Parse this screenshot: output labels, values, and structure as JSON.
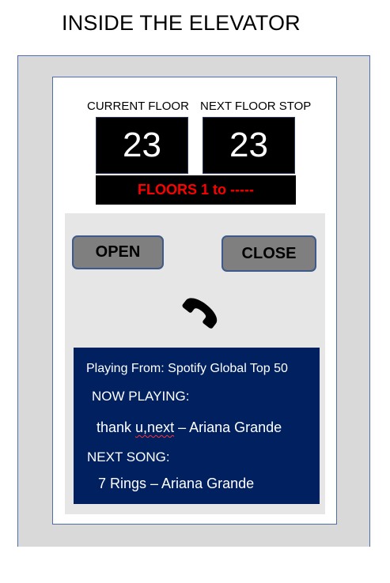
{
  "page": {
    "title": "INSIDE THE ELEVATOR"
  },
  "floor_display": {
    "current_label": "CURRENT FLOOR",
    "current_value": "23",
    "next_label": "NEXT FLOOR STOP",
    "next_value": "23",
    "range_text": "FLOORS 1 to -----",
    "range_color": "#ff0000"
  },
  "controls": {
    "open_label": "OPEN",
    "close_label": "CLOSE",
    "phone_icon": "phone-icon"
  },
  "music": {
    "source": "Playing From: Spotify Global Top 50",
    "now_playing_label": "NOW PLAYING:",
    "now_playing_prefix": "thank ",
    "now_playing_marked": "u,next",
    "now_playing_suffix": " – Ariana Grande",
    "next_song_label": "NEXT SONG:",
    "next_song": "7 Rings – Ariana Grande",
    "background_color": "#002060"
  }
}
